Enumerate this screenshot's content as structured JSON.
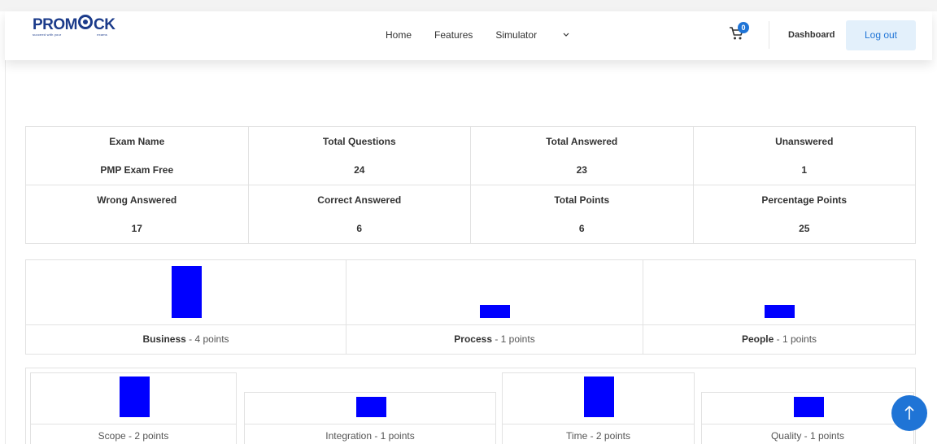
{
  "brand": {
    "logo_text": "PROMOCK",
    "tagline_left": "succeed with your",
    "tagline_right": "exams"
  },
  "nav": {
    "home": "Home",
    "features": "Features",
    "simulator": "Simulator"
  },
  "header": {
    "cart_count": "0",
    "dashboard": "Dashboard",
    "logout": "Log out"
  },
  "stats": {
    "row1_headers": [
      "Exam Name",
      "Total Questions",
      "Total Answered",
      "Unanswered"
    ],
    "row1_values": [
      "PMP Exam Free",
      "24",
      "23",
      "1"
    ],
    "row2_headers": [
      "Wrong Answered",
      "Correct Answered",
      "Total Points",
      "Percentage Points"
    ],
    "row2_values": [
      "17",
      "6",
      "6",
      "25"
    ]
  },
  "chart_data": [
    {
      "type": "bar",
      "categories": [
        "Business",
        "Process",
        "People"
      ],
      "values": [
        4,
        1,
        1
      ],
      "labels": [
        {
          "name": "Business",
          "suffix": " - 4 points"
        },
        {
          "name": "Process",
          "suffix": " - 1 points"
        },
        {
          "name": "People",
          "suffix": " - 1 points"
        }
      ],
      "bar_color": "#0000ff"
    },
    {
      "type": "bar",
      "categories": [
        "Scope",
        "Integration",
        "Time",
        "Quality"
      ],
      "values": [
        2,
        1,
        2,
        1
      ],
      "labels": [
        "Scope - 2 points",
        "Integration - 1 points",
        "Time - 2 points",
        "Quality - 1 points"
      ],
      "bar_color": "#0000ff"
    }
  ],
  "colors": {
    "accent": "#1f74d6",
    "bar": "#0000ff",
    "logout_bg": "#e3f0fb"
  },
  "icons": {
    "cart": "cart-icon",
    "chevron": "chevron-down-icon",
    "scroll_top": "arrow-up-icon"
  }
}
